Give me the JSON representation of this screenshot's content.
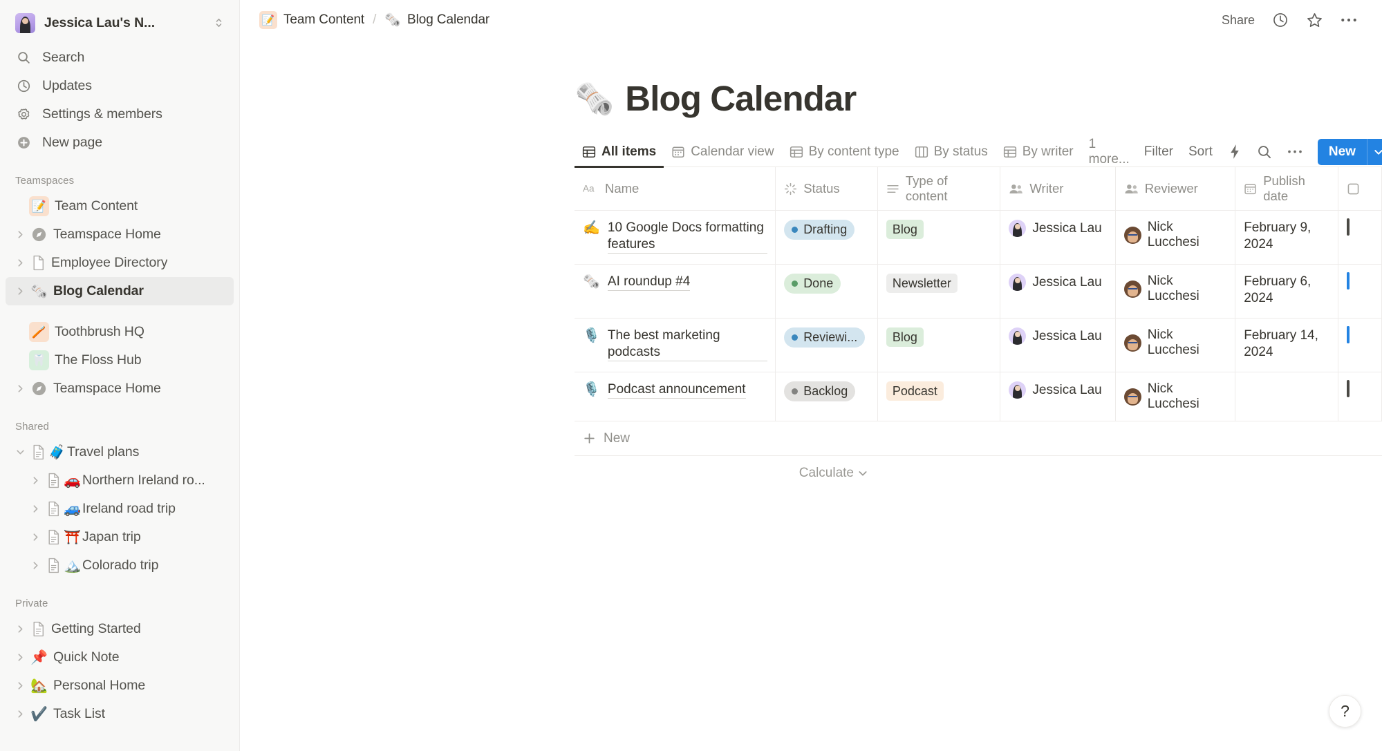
{
  "sidebar": {
    "workspace": {
      "name": "Jessica Lau's N...",
      "avatar": "user-avatar"
    },
    "nav": [
      {
        "label": "Search",
        "icon": "search-icon"
      },
      {
        "label": "Updates",
        "icon": "clock-icon"
      },
      {
        "label": "Settings & members",
        "icon": "gear-icon"
      },
      {
        "label": "New page",
        "icon": "plus-circle-icon"
      }
    ],
    "teamspaces": {
      "title": "Teamspaces",
      "items": [
        {
          "label": "Team Content",
          "icon": "orange-note-icon",
          "emoji": "📝",
          "bg": "#fae0cd",
          "type": "teamspace"
        },
        {
          "label": "Teamspace Home",
          "icon": "compass-icon",
          "type": "page",
          "twisty": true
        },
        {
          "label": "Employee Directory",
          "icon": "doc-icon",
          "type": "page",
          "twisty": true
        },
        {
          "label": "Blog Calendar",
          "emoji": "🗞️",
          "type": "page",
          "twisty": true,
          "selected": true
        },
        {
          "label": "Toothbrush HQ",
          "emoji": "🪥",
          "bg": "#fae0cd",
          "type": "teamspace"
        },
        {
          "label": "The Floss Hub",
          "emoji": "🦷",
          "bg": "#d7efdc",
          "type": "teamspace"
        },
        {
          "label": "Teamspace Home",
          "icon": "compass-icon",
          "type": "page",
          "twisty": true
        }
      ]
    },
    "shared": {
      "title": "Shared",
      "items": [
        {
          "label": "Travel plans",
          "emoji": "🧳",
          "icon": "doc-icon",
          "twisty": "open",
          "depth": 0
        },
        {
          "label": "Northern Ireland ro...",
          "emoji": "🚗",
          "icon": "doc-icon",
          "twisty": true,
          "depth": 1
        },
        {
          "label": "Ireland road trip",
          "emoji": "🚙",
          "icon": "doc-icon",
          "twisty": true,
          "depth": 1
        },
        {
          "label": "Japan trip",
          "emoji": "⛩️",
          "icon": "doc-icon",
          "twisty": true,
          "depth": 1
        },
        {
          "label": "Colorado trip",
          "emoji": "🏔️",
          "icon": "doc-icon",
          "twisty": true,
          "depth": 1
        }
      ]
    },
    "private": {
      "title": "Private",
      "items": [
        {
          "label": "Getting Started",
          "icon": "doc-icon",
          "twisty": true
        },
        {
          "label": "Quick Note",
          "emoji": "📌",
          "twisty": true
        },
        {
          "label": "Personal Home",
          "emoji": "🏡",
          "twisty": true
        },
        {
          "label": "Task List",
          "emoji": "✔️",
          "twisty": true
        }
      ]
    }
  },
  "topbar": {
    "breadcrumb": {
      "parent": "Team Content",
      "separator": "/",
      "current": "Blog Calendar",
      "current_emoji": "🗞️",
      "parent_emoji": "📝"
    },
    "share_label": "Share",
    "actions": [
      "clock-icon",
      "star-icon",
      "more-icon"
    ]
  },
  "page": {
    "emoji": "🗞️",
    "title": "Blog Calendar"
  },
  "views": {
    "tabs": [
      {
        "label": "All items",
        "icon": "table-icon",
        "active": true
      },
      {
        "label": "Calendar view",
        "icon": "calendar-icon",
        "active": false
      },
      {
        "label": "By content type",
        "icon": "table-icon",
        "active": false
      },
      {
        "label": "By status",
        "icon": "board-icon",
        "active": false
      },
      {
        "label": "By writer",
        "icon": "table-icon",
        "active": false
      }
    ],
    "more_label": "1 more...",
    "filter_label": "Filter",
    "sort_label": "Sort",
    "automation_icon": "lightning-icon",
    "search_icon": "search-icon",
    "more_icon": "more-icon",
    "new_label": "New",
    "new_caret_icon": "chevron-down-icon"
  },
  "table": {
    "columns": [
      {
        "label": "Name",
        "icon": "title-icon"
      },
      {
        "label": "Status",
        "icon": "status-icon"
      },
      {
        "label": "Type of content",
        "icon": "select-icon"
      },
      {
        "label": "Writer",
        "icon": "person-icon"
      },
      {
        "label": "Reviewer",
        "icon": "person-icon"
      },
      {
        "label": "Publish date",
        "icon": "date-icon"
      },
      {
        "label": "",
        "icon": "checkbox-icon"
      }
    ],
    "rows": [
      {
        "emoji": "✍️",
        "name": "10 Google Docs formatting features",
        "status": {
          "label": "Drafting",
          "bg": "#d3e5ef",
          "dot": "#3a87bd"
        },
        "type": {
          "label": "Blog",
          "bg": "#dbeddb"
        },
        "writer": "Jessica Lau",
        "reviewer": "Nick Lucchesi",
        "publish_date": "February 9, 2024",
        "checked": false
      },
      {
        "emoji": "🗞️",
        "name": "AI roundup #4",
        "status": {
          "label": "Done",
          "bg": "#dbeddb",
          "dot": "#5a9c68"
        },
        "type": {
          "label": "Newsletter",
          "bg": "#ededec"
        },
        "writer": "Jessica Lau",
        "reviewer": "Nick Lucchesi",
        "publish_date": "February 6, 2024",
        "checked": true
      },
      {
        "emoji": "🎙️",
        "name": "The best marketing podcasts",
        "status": {
          "label": "Reviewi...",
          "bg": "#d3e5ef",
          "dot": "#3a87bd"
        },
        "type": {
          "label": "Blog",
          "bg": "#dbeddb"
        },
        "writer": "Jessica Lau",
        "reviewer": "Nick Lucchesi",
        "publish_date": "February 14, 2024",
        "checked": true
      },
      {
        "emoji": "🎙️",
        "name": "Podcast announcement",
        "status": {
          "label": "Backlog",
          "bg": "#e3e2e0",
          "dot": "#838381"
        },
        "type": {
          "label": "Podcast",
          "bg": "#fbecdd"
        },
        "writer": "Jessica Lau",
        "reviewer": "Nick Lucchesi",
        "publish_date": "",
        "checked": false
      }
    ],
    "new_row_label": "New",
    "calculate_label": "Calculate"
  },
  "help": {
    "label": "?"
  },
  "colors": {
    "accent": "#2383e2",
    "text": "#37352f",
    "muted": "#8f8e89",
    "sidebar_bg": "#f8f8f7"
  }
}
